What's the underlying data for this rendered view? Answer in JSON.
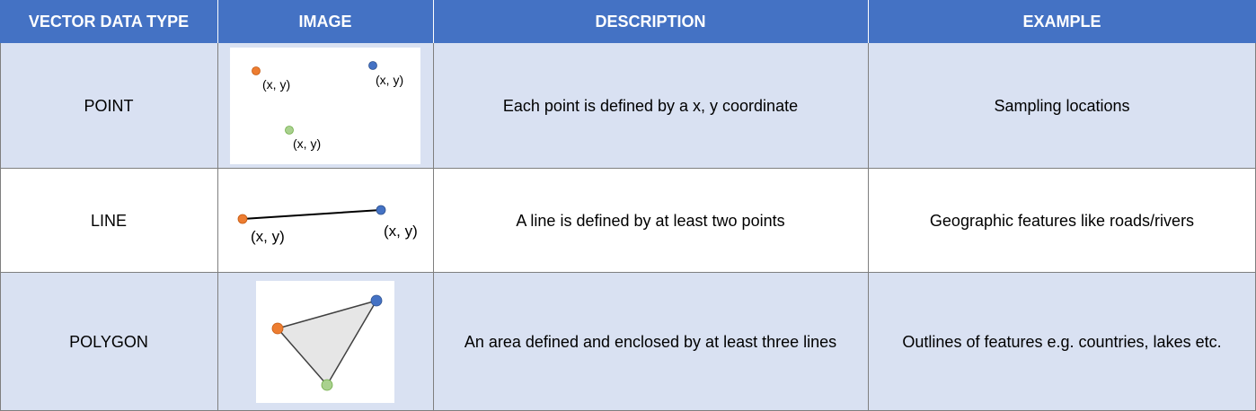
{
  "header": {
    "col1": "VECTOR DATA TYPE",
    "col2": "IMAGE",
    "col3": "DESCRIPTION",
    "col4": "EXAMPLE"
  },
  "rows": [
    {
      "type": "POINT",
      "image_labels": [
        "(x, y)",
        "(x, y)",
        "(x, y)"
      ],
      "description": "Each point is defined by a x, y coordinate",
      "example": "Sampling locations"
    },
    {
      "type": "LINE",
      "image_labels": [
        "(x, y)",
        "(x, y)"
      ],
      "description": "A line is defined by at least two points",
      "example": "Geographic features like roads/rivers"
    },
    {
      "type": "POLYGON",
      "description": "An area defined and enclosed by at least three lines",
      "example": "Outlines of features e.g. countries, lakes etc."
    }
  ],
  "colors": {
    "header_bg": "#4472c4",
    "band_bg": "#d9e1f2",
    "point_orange": "#ed7d31",
    "point_blue": "#4472c4",
    "point_green": "#a9d18e",
    "polygon_fill": "#e6e6e6"
  }
}
